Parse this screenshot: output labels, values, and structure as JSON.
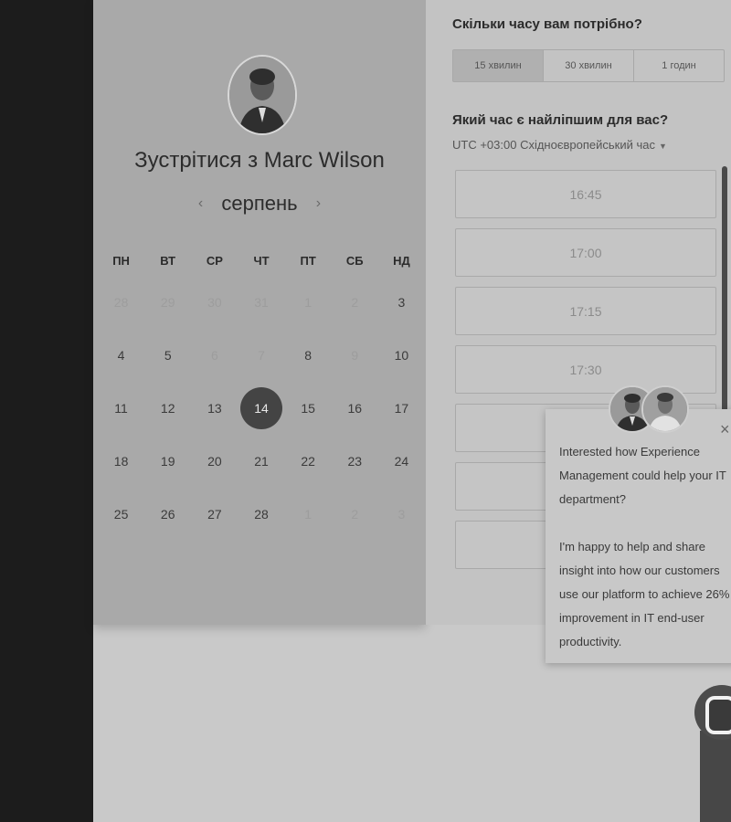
{
  "calendar": {
    "title": "Зустрітися з Marc Wilson",
    "month": "серпень",
    "prev_arrow": "‹",
    "next_arrow": "›",
    "weekdays": [
      "ПН",
      "ВТ",
      "СР",
      "ЧТ",
      "ПТ",
      "СБ",
      "НД"
    ],
    "weeks": [
      [
        "28",
        "29",
        "30",
        "31",
        "1",
        "2",
        "3"
      ],
      [
        "4",
        "5",
        "6",
        "7",
        "8",
        "9",
        "10"
      ],
      [
        "11",
        "12",
        "13",
        "14",
        "15",
        "16",
        "17"
      ],
      [
        "18",
        "19",
        "20",
        "21",
        "22",
        "23",
        "24"
      ],
      [
        "25",
        "26",
        "27",
        "28",
        "1",
        "2",
        "3"
      ]
    ],
    "selected": "14"
  },
  "booking": {
    "duration_title": "Скільки часу вам потрібно?",
    "durations": [
      "15 хвилин",
      "30 хвилин",
      "1 годин"
    ],
    "time_title": "Який час є найліпшим для вас?",
    "timezone": "UTC +03:00 Східноєвропейський час",
    "slots": [
      "16:45",
      "17:00",
      "17:15",
      "17:30",
      "",
      "",
      "",
      ""
    ]
  },
  "chat": {
    "close": "×",
    "paragraph1": "Interested how Experience Management could help your IT department?",
    "paragraph2": "I'm happy to help and share insight into how our customers use our platform to achieve 26% improvement in IT end-user productivity."
  },
  "colors": {
    "selected_day": "#444444",
    "panel": "#a9a9a9"
  }
}
